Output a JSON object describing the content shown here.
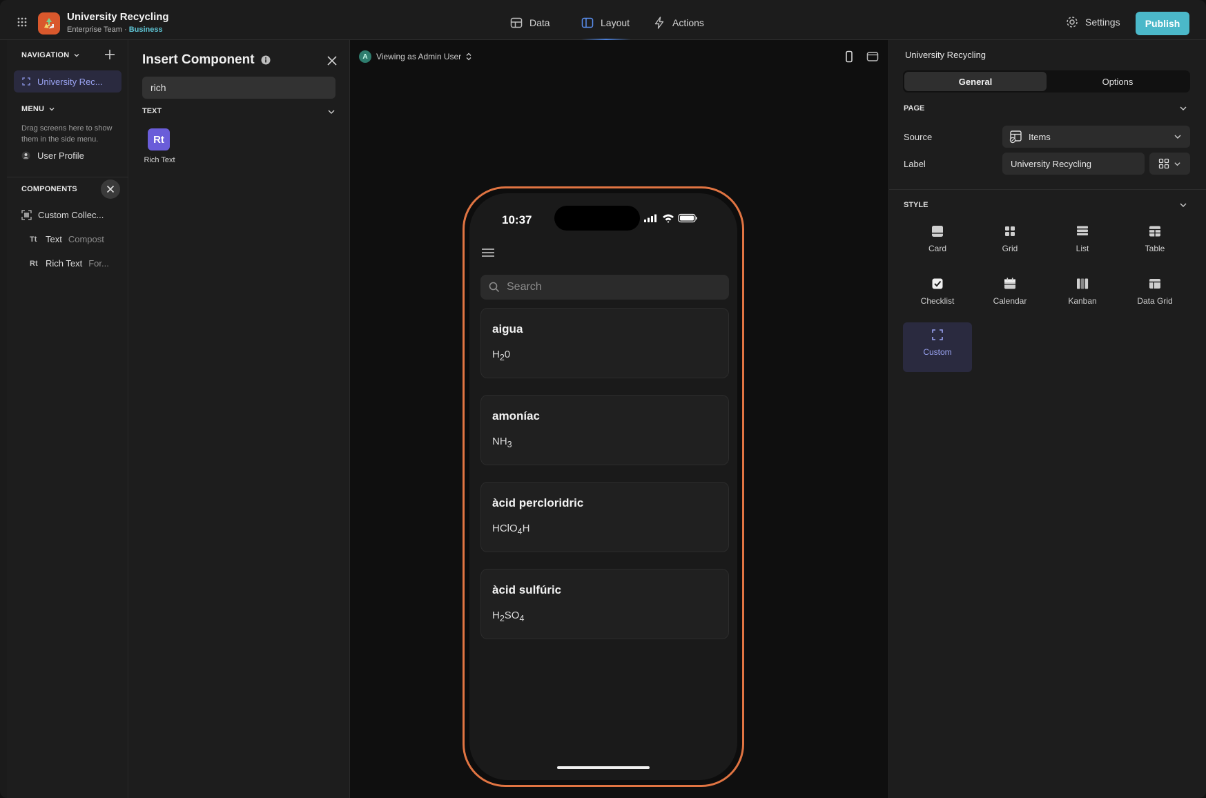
{
  "header": {
    "app_title": "University Recycling",
    "team": "Enterprise Team",
    "separator": "·",
    "plan": "Business",
    "tabs": [
      {
        "label": "Data",
        "icon": "table-icon"
      },
      {
        "label": "Layout",
        "icon": "layout-icon"
      },
      {
        "label": "Actions",
        "icon": "lightning-icon"
      }
    ],
    "settings_label": "Settings",
    "publish_label": "Publish",
    "accent": "#4bb8c9"
  },
  "navigation": {
    "header": "NAVIGATION",
    "active_item": "University Rec...",
    "menu_header": "MENU",
    "menu_help": "Drag screens here to show them in the side menu.",
    "user_profile": "User Profile"
  },
  "components": {
    "header": "COMPONENTS",
    "items": [
      {
        "label": "Custom Collec...",
        "sub": "",
        "icon": "collection-icon"
      },
      {
        "label": "Text",
        "sub": "Compost",
        "icon": "text-icon"
      },
      {
        "label": "Rich Text",
        "sub": "For...",
        "icon": "rich-text-icon"
      }
    ]
  },
  "insert_panel": {
    "title": "Insert Component",
    "search_value": "rich",
    "section": "TEXT",
    "tile_glyph": "Rt",
    "tile_label": "Rich Text"
  },
  "canvas": {
    "viewing_avatar": "A",
    "viewing_label": "Viewing as Admin User",
    "phone": {
      "time": "10:37",
      "search_placeholder": "Search",
      "cards": [
        {
          "title": "aigua",
          "formula": [
            {
              "t": "H"
            },
            {
              "s": "2"
            },
            {
              "t": "0"
            }
          ]
        },
        {
          "title": "amoníac",
          "formula": [
            {
              "t": "NH"
            },
            {
              "s": "3"
            }
          ]
        },
        {
          "title": "àcid percloridric",
          "formula": [
            {
              "t": "HClO"
            },
            {
              "s": "4"
            },
            {
              "t": "H"
            }
          ]
        },
        {
          "title": "àcid sulfúric",
          "formula": [
            {
              "t": "H"
            },
            {
              "s": "2"
            },
            {
              "t": "SO"
            },
            {
              "s": "4"
            }
          ]
        }
      ],
      "frame_color": "#e07442"
    }
  },
  "right_panel": {
    "title": "University Recycling",
    "tabs": {
      "general": "General",
      "options": "Options"
    },
    "page_section": "PAGE",
    "source_label": "Source",
    "source_value": "Items",
    "label_label": "Label",
    "label_value": "University Recycling",
    "style_section": "STYLE",
    "styles": [
      {
        "label": "Card",
        "icon": "card-icon"
      },
      {
        "label": "Grid",
        "icon": "grid-icon"
      },
      {
        "label": "List",
        "icon": "list-icon"
      },
      {
        "label": "Table",
        "icon": "table-icon"
      },
      {
        "label": "Checklist",
        "icon": "checklist-icon"
      },
      {
        "label": "Calendar",
        "icon": "calendar-icon"
      },
      {
        "label": "Kanban",
        "icon": "kanban-icon"
      },
      {
        "label": "Data Grid",
        "icon": "data-grid-icon"
      },
      {
        "label": "Custom",
        "icon": "custom-icon"
      }
    ],
    "active_style": "Custom"
  }
}
